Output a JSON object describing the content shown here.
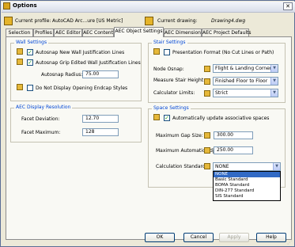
{
  "window": {
    "title": "Options"
  },
  "header": {
    "current_profile_label": "Current profile:",
    "current_profile_value": "AutoCAD Arc...ure [US Metric]",
    "current_drawing_label": "Current drawing:",
    "current_drawing_value": "Drawing4.dwg"
  },
  "tabs": [
    {
      "label": "Selection"
    },
    {
      "label": "Profiles"
    },
    {
      "label": "AEC Editor"
    },
    {
      "label": "AEC Content"
    },
    {
      "label": "AEC Object Settings",
      "active": true
    },
    {
      "label": "AEC Dimension"
    },
    {
      "label": "AEC Project Defaults"
    }
  ],
  "wall_settings": {
    "title": "Wall Settings",
    "autosnap_new_wall": "Autosnap New Wall Justification Lines",
    "autosnap_grip_edited": "Autosnap Grip Edited Wall Justification Lines",
    "autosnap_radius_label": "Autosnap Radius:",
    "autosnap_radius_value": "75.00",
    "do_not_display_endcap": "Do Not Display Opening Endcap Styles"
  },
  "aec_display_resolution": {
    "title": "AEC Display Resolution",
    "facet_deviation_label": "Facet Deviation:",
    "facet_deviation_value": "12.70",
    "facet_maximum_label": "Facet Maximum:",
    "facet_maximum_value": "128"
  },
  "stair_settings": {
    "title": "Stair Settings",
    "presentation_format": "Presentation Format (No Cut Lines or Path)",
    "node_osnap_label": "Node Osnap:",
    "node_osnap_value": "Flight & Landing Corners",
    "measure_stair_height_label": "Measure Stair Height:",
    "measure_stair_height_value": "Finished Floor to Floor",
    "calculator_limits_label": "Calculator Limits:",
    "calculator_limits_value": "Strict"
  },
  "space_settings": {
    "title": "Space Settings",
    "auto_update": "Automatically update associative spaces",
    "max_gap_size_label": "Maximum Gap Size:",
    "max_gap_size_value": "300.00",
    "max_auto_adjacency_label": "Maximum Automatic Adjacency:",
    "max_auto_adjacency_value": "250.00",
    "calc_standard_label": "Calculation Standard:",
    "calc_standard_value": "NONE",
    "calc_standard_options": [
      "NONE",
      "Basic Standard",
      "BOMA Standard",
      "DIN-277 Standard",
      "SIS Standard"
    ]
  },
  "buttons": {
    "ok": "OK",
    "cancel": "Cancel",
    "apply": "Apply",
    "help": "Help"
  },
  "icons": {
    "title": "autocad-app-icon",
    "close": "close-icon",
    "dropdown": "chevron-down-icon",
    "setting": "drawing-setting-icon"
  },
  "colors": {
    "group_title": "#0046d5",
    "selected_item": "#316ac5",
    "checkbox_check": "#21a121"
  }
}
